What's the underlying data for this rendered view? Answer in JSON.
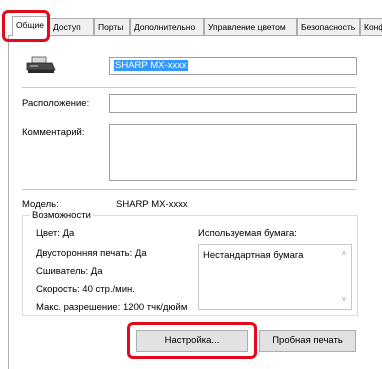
{
  "tabs": [
    {
      "label": "Общие",
      "active": true
    },
    {
      "label": "Доступ",
      "active": false
    },
    {
      "label": "Порты",
      "active": false
    },
    {
      "label": "Дополнительно",
      "active": false
    },
    {
      "label": "Управление цветом",
      "active": false
    },
    {
      "label": "Безопасность",
      "active": false
    },
    {
      "label": "Конф",
      "active": false
    }
  ],
  "printer": {
    "icon": "printer-icon",
    "name": "SHARP MX-xxxx"
  },
  "fields": {
    "location_label": "Расположение:",
    "location_value": "",
    "comment_label": "Комментарий:",
    "comment_value": ""
  },
  "model": {
    "label": "Модель:",
    "value": "SHARP MX-xxxx"
  },
  "features": {
    "title": "Возможности",
    "color": "Цвет: Да",
    "duplex": "Двусторонняя печать: Да",
    "staple": "Сшиватель: Да",
    "speed": "Скорость: 40 стр./мин.",
    "resolution": "Макс. разрешение: 1200 тчк/дюйм",
    "paper_label": "Используемая бумага:",
    "paper_items": [
      "Нестандартная бумага"
    ]
  },
  "buttons": {
    "setup": "Настройка...",
    "test_print": "Пробная печать"
  },
  "highlight_color": "#e20a1c"
}
